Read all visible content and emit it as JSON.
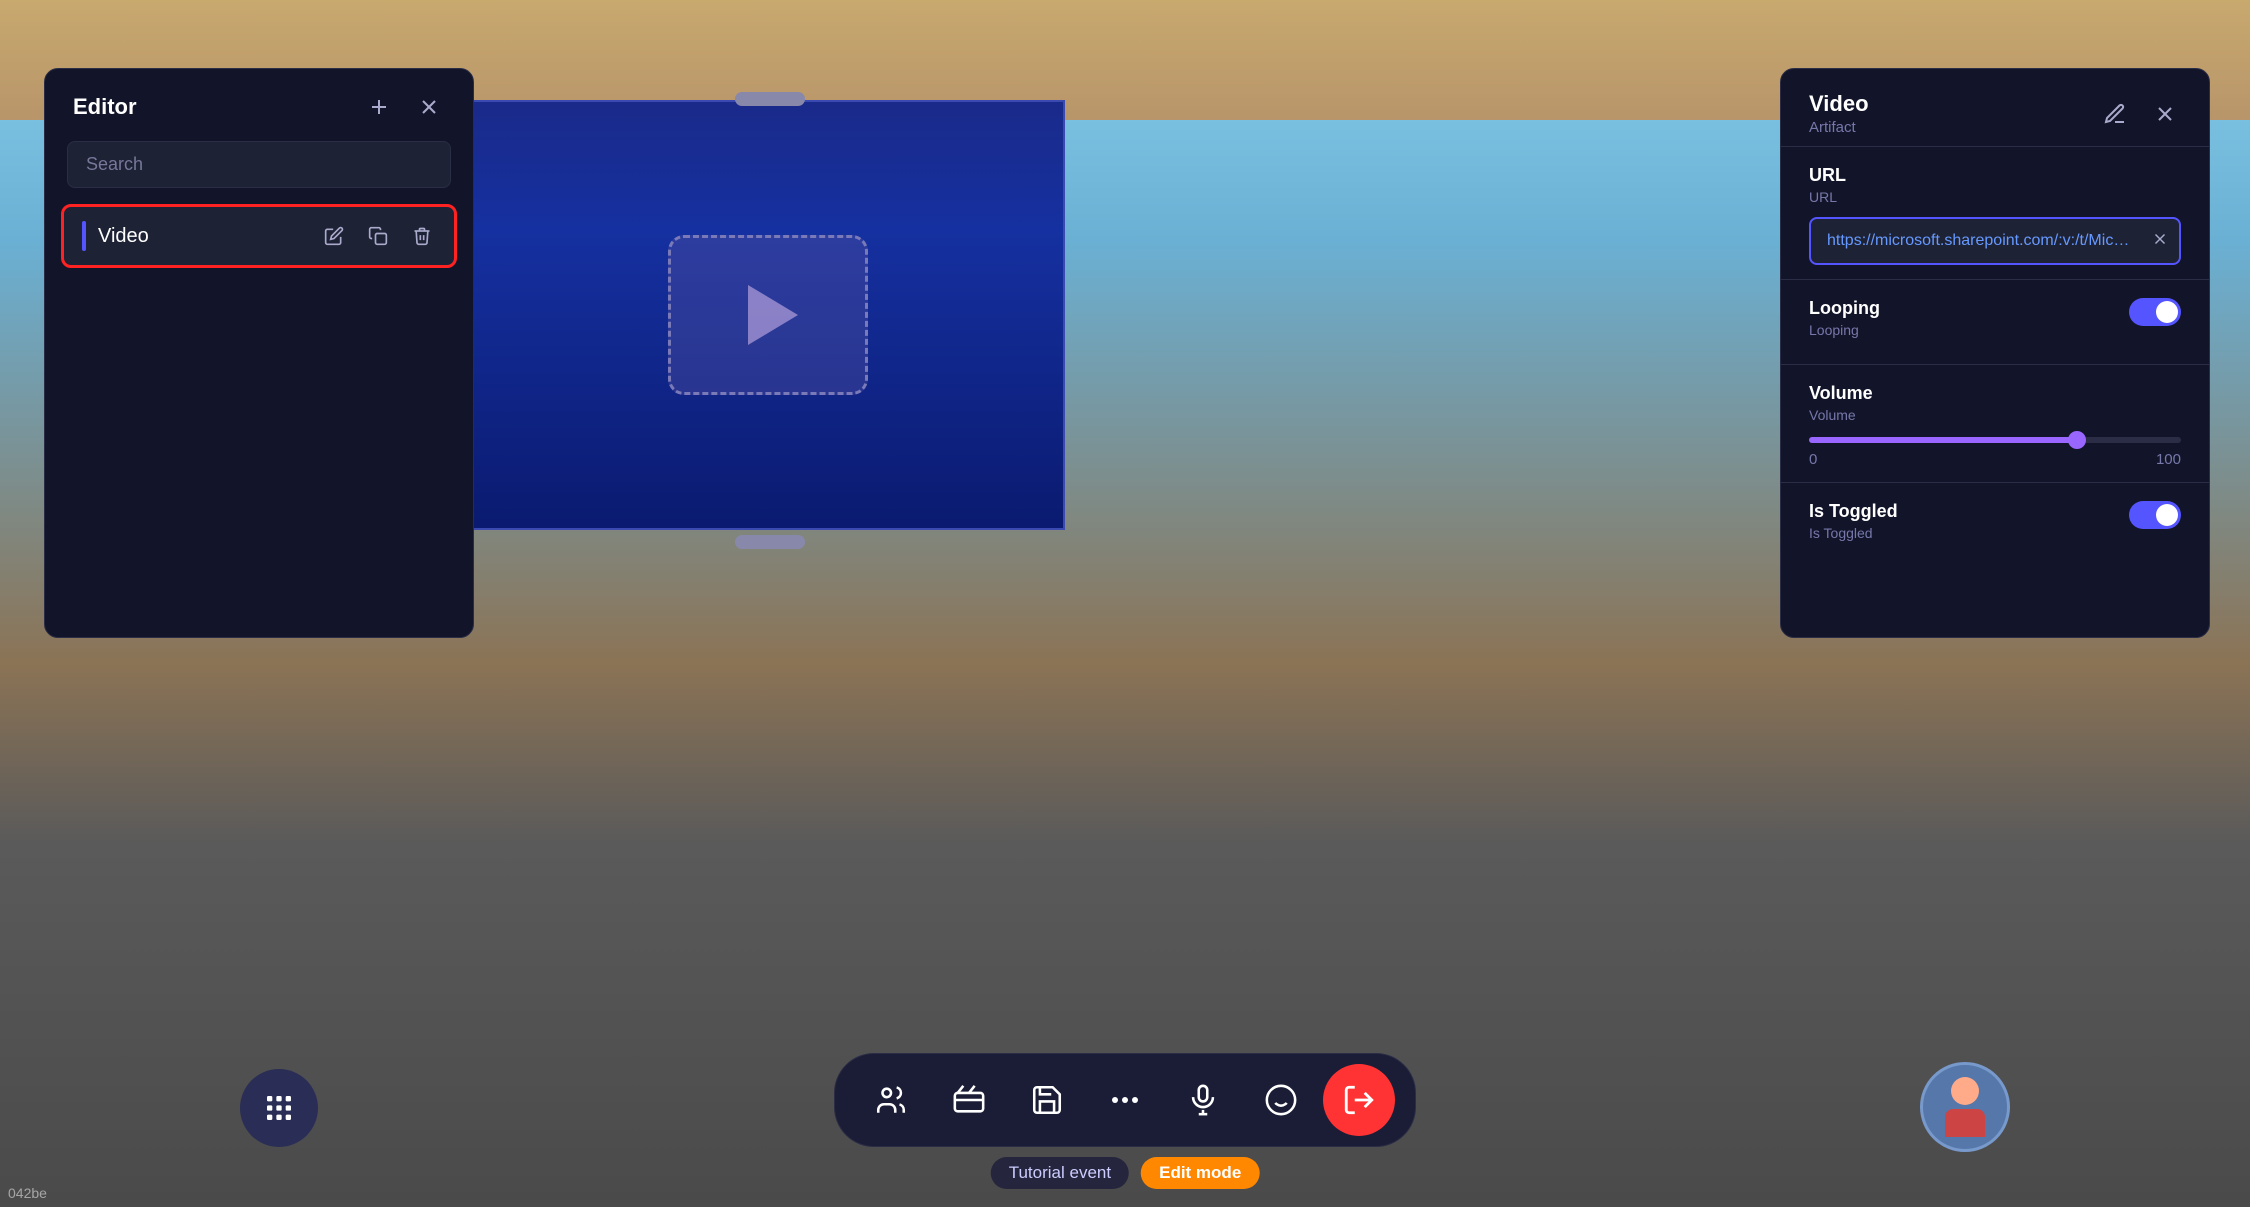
{
  "background": {
    "sky_color": "#87CEEB",
    "ground_color": "#5a5a5a"
  },
  "editor_panel": {
    "title": "Editor",
    "search_placeholder": "Search",
    "add_label": "+",
    "close_label": "×",
    "items": [
      {
        "id": "video",
        "label": "Video",
        "selected": true
      }
    ]
  },
  "artifact_panel": {
    "title": "Video",
    "subtitle": "Artifact",
    "edit_label": "✏",
    "close_label": "×",
    "url_section": {
      "label": "URL",
      "sublabel": "URL",
      "value": "https://microsoft.sharepoint.com/:v:/t/Microsol"
    },
    "looping_section": {
      "label": "Looping",
      "sublabel": "Looping",
      "enabled": true
    },
    "volume_section": {
      "label": "Volume",
      "sublabel": "Volume",
      "min": "0",
      "max": "100",
      "value": 72
    },
    "is_toggled_section": {
      "label": "Is Toggled",
      "sublabel": "Is Toggled",
      "enabled": true
    }
  },
  "bottom_toolbar": {
    "buttons": [
      {
        "id": "people",
        "icon": "👥"
      },
      {
        "id": "movie",
        "icon": "🎬"
      },
      {
        "id": "save",
        "icon": "💾"
      },
      {
        "id": "more",
        "icon": "···"
      },
      {
        "id": "mic",
        "icon": "🎤"
      },
      {
        "id": "emoji",
        "icon": "🙂"
      },
      {
        "id": "exit",
        "icon": "🚪"
      }
    ]
  },
  "status_bar": {
    "event_label": "Tutorial event",
    "mode_label": "Edit mode"
  },
  "bottom_left_text": "042be"
}
